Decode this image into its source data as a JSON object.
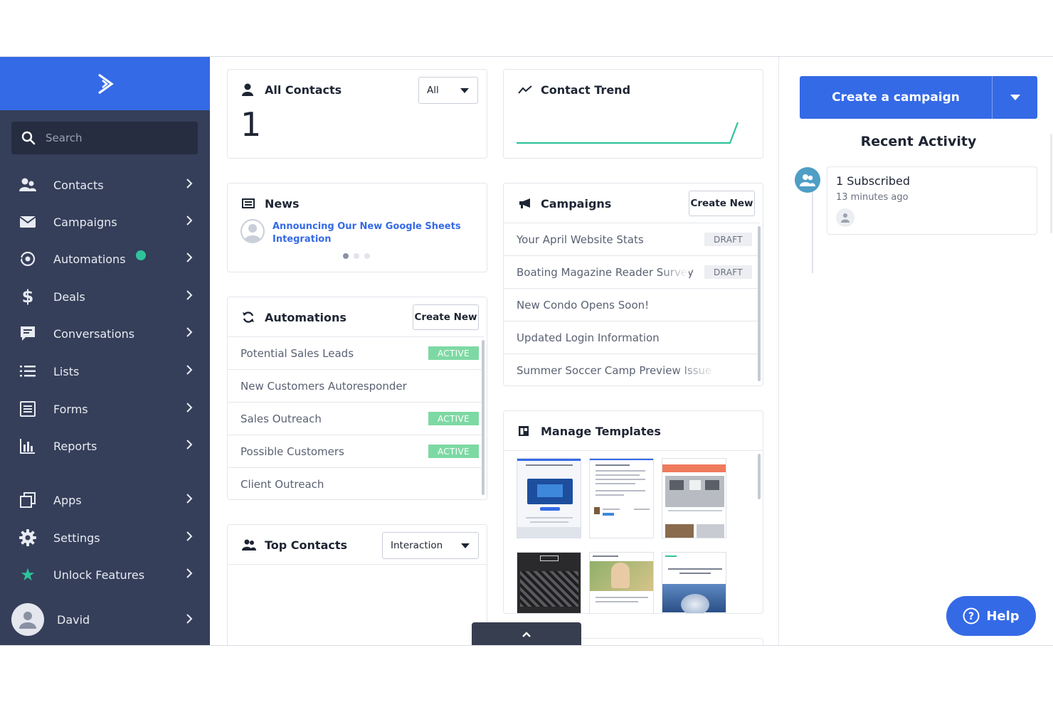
{
  "colors": {
    "brand": "#356ae6",
    "sidebar": "#353f5a",
    "active": "#7dd9a3",
    "trend": "#2fc39a"
  },
  "sidebar": {
    "search_placeholder": "Search",
    "items": [
      {
        "label": "Contacts",
        "icon": "contacts-icon"
      },
      {
        "label": "Campaigns",
        "icon": "envelope-icon"
      },
      {
        "label": "Automations",
        "icon": "automations-icon"
      },
      {
        "label": "Deals",
        "icon": "dollar-icon"
      },
      {
        "label": "Conversations",
        "icon": "chat-icon"
      },
      {
        "label": "Lists",
        "icon": "list-icon"
      },
      {
        "label": "Forms",
        "icon": "form-icon"
      },
      {
        "label": "Reports",
        "icon": "bar-chart-icon"
      },
      {
        "label": "Apps",
        "icon": "apps-icon"
      },
      {
        "label": "Settings",
        "icon": "gear-icon"
      },
      {
        "label": "Unlock Features",
        "icon": "star-icon"
      }
    ],
    "user": "David"
  },
  "all_contacts": {
    "title": "All Contacts",
    "filter": "All",
    "count": "1"
  },
  "contact_trend": {
    "title": "Contact Trend"
  },
  "news": {
    "title": "News",
    "headline": "Announcing Our New Google Sheets Integration"
  },
  "automations": {
    "title": "Automations",
    "create_label": "Create New",
    "rows": [
      {
        "name": "Potential Sales Leads",
        "status": "ACTIVE"
      },
      {
        "name": "New Customers Autoresponder",
        "status": ""
      },
      {
        "name": "Sales Outreach",
        "status": "ACTIVE"
      },
      {
        "name": "Possible Customers",
        "status": "ACTIVE"
      },
      {
        "name": "Client Outreach",
        "status": ""
      }
    ]
  },
  "campaigns": {
    "title": "Campaigns",
    "create_label": "Create New",
    "rows": [
      {
        "name": "Your April Website Stats",
        "status": "DRAFT"
      },
      {
        "name": "Boating Magazine Reader Survey",
        "status": "DRAFT"
      },
      {
        "name": "New Condo Opens Soon!",
        "status": ""
      },
      {
        "name": "Updated Login Information",
        "status": ""
      },
      {
        "name": "Summer Soccer Camp Preview Issue",
        "status": ""
      }
    ]
  },
  "top_contacts": {
    "title": "Top Contacts",
    "filter": "Interaction"
  },
  "templates": {
    "title": "Manage Templates"
  },
  "right": {
    "cta_label": "Create a campaign",
    "recent_title": "Recent Activity",
    "activity": {
      "title": "1 Subscribed",
      "time": "13 minutes ago"
    },
    "help_label": "Help"
  }
}
